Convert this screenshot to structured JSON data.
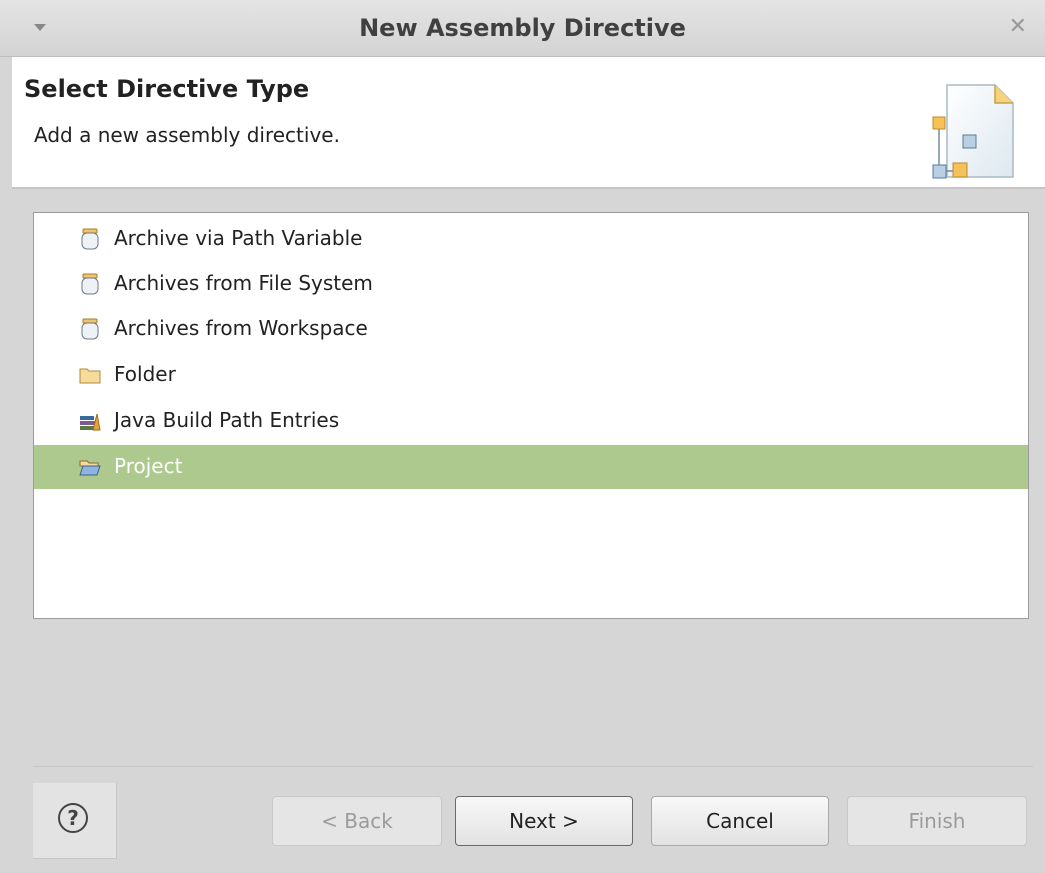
{
  "window": {
    "title": "New Assembly Directive"
  },
  "header": {
    "title": "Select Directive Type",
    "description": "Add a new assembly directive."
  },
  "list": {
    "items": [
      {
        "label": "Archive via Path Variable",
        "icon": "jar-icon",
        "selected": false
      },
      {
        "label": "Archives from File System",
        "icon": "jar-icon",
        "selected": false
      },
      {
        "label": "Archives from Workspace",
        "icon": "jar-icon",
        "selected": false
      },
      {
        "label": "Folder",
        "icon": "folder-icon",
        "selected": false
      },
      {
        "label": "Java Build Path Entries",
        "icon": "library-icon",
        "selected": false
      },
      {
        "label": "Project",
        "icon": "open-folder-icon",
        "selected": true
      }
    ]
  },
  "buttons": {
    "help": "?",
    "back": "< Back",
    "next": "Next >",
    "cancel": "Cancel",
    "finish": "Finish"
  },
  "colors": {
    "selection": "#aec98e",
    "dialog_bg": "#d6d6d6"
  }
}
